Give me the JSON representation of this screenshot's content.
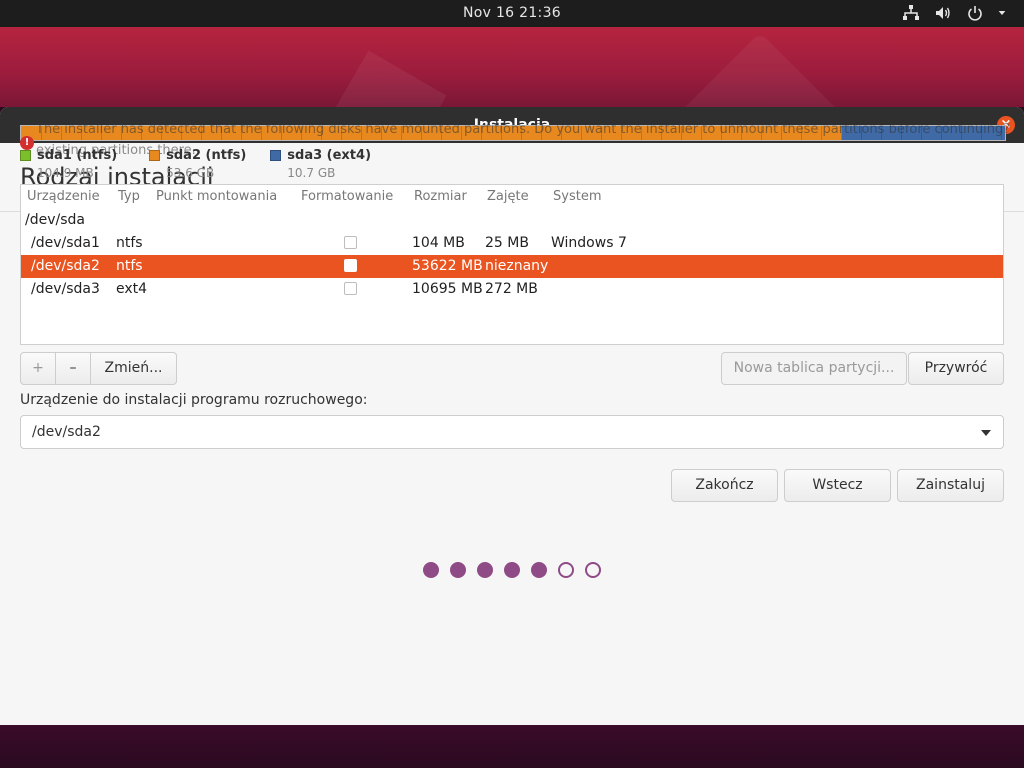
{
  "topbar": {
    "clock": "Nov 16  21:36",
    "tray_icons": [
      "network-icon",
      "volume-icon",
      "power-icon",
      "menu-arrow-icon"
    ]
  },
  "window": {
    "title": "Instalacja",
    "close_icon": "close-icon"
  },
  "page": {
    "heading": "Rodzaj instalacji",
    "overlay_line1": "The installer has detected that the following disks have mounted partitions. Do you want the installer to unmount these partitions before continuing?",
    "overlay_line2": "existing partitions there."
  },
  "partitions_bar": {
    "colors": {
      "sda1": "#7bbf2a",
      "sda2": "#e8891f",
      "sda3": "#3f6aa6"
    }
  },
  "legend": [
    {
      "name": "sda1 (ntfs)",
      "size": "104.9 MB",
      "color": "#7bbf2a"
    },
    {
      "name": "sda2 (ntfs)",
      "size": "53.6 GB",
      "color": "#e8891f"
    },
    {
      "name": "sda3 (ext4)",
      "size": "10.7 GB",
      "color": "#3f6aa6"
    }
  ],
  "table": {
    "headers": [
      "Urządzenie",
      "Typ",
      "Punkt montowania",
      "Formatowanie",
      "Rozmiar",
      "Zajęte",
      "System"
    ],
    "device_group": "/dev/sda",
    "rows": [
      {
        "device": "/dev/sda1",
        "type": "ntfs",
        "mount": "",
        "format": false,
        "size": "104 MB",
        "used": "25 MB",
        "system": "Windows 7",
        "selected": false
      },
      {
        "device": "/dev/sda2",
        "type": "ntfs",
        "mount": "",
        "format": false,
        "size": "53622 MB",
        "used": "nieznany",
        "system": "",
        "selected": true
      },
      {
        "device": "/dev/sda3",
        "type": "ext4",
        "mount": "",
        "format": false,
        "size": "10695 MB",
        "used": "272 MB",
        "system": "",
        "selected": false
      }
    ]
  },
  "toolbar": {
    "add_label": "+",
    "remove_label": "–",
    "change_label": "Zmień...",
    "new_table_label": "Nowa tablica partycji...",
    "revert_label": "Przywróć"
  },
  "boot": {
    "label": "Urządzenie do instalacji programu rozruchowego:",
    "value": "/dev/sda2"
  },
  "nav": {
    "quit_label": "Zakończ",
    "back_label": "Wstecz",
    "install_label": "Zainstaluj"
  },
  "progress": {
    "total_steps": 7,
    "completed_steps": 5,
    "accent": "#8e4b86"
  }
}
